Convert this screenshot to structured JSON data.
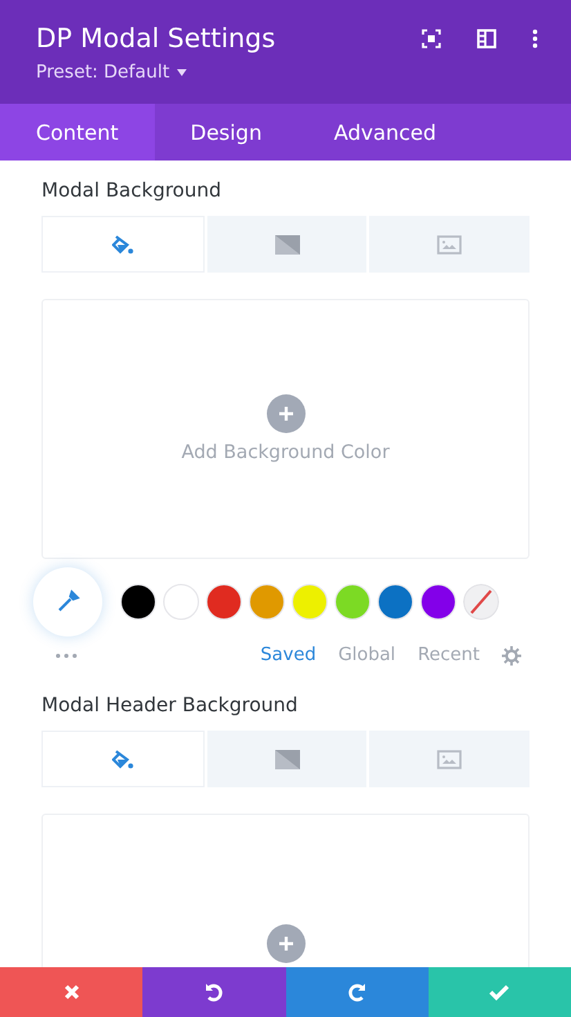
{
  "header": {
    "title": "DP Modal Settings",
    "preset": "Preset: Default"
  },
  "tabs": [
    {
      "label": "Content",
      "selected": true
    },
    {
      "label": "Design",
      "selected": false
    },
    {
      "label": "Advanced",
      "selected": false
    }
  ],
  "sections": [
    {
      "title": "Modal Background",
      "bg_types": [
        {
          "kind": "color",
          "selected": true
        },
        {
          "kind": "gradient",
          "selected": false
        },
        {
          "kind": "image",
          "selected": false
        }
      ],
      "add_label": "Add Background Color",
      "palette": {
        "swatches": [
          {
            "kind": "color",
            "color": "#000000"
          },
          {
            "kind": "color",
            "color": "#ffffff"
          },
          {
            "kind": "color",
            "color": "#e02b20"
          },
          {
            "kind": "color",
            "color": "#e09900"
          },
          {
            "kind": "color",
            "color": "#edf000"
          },
          {
            "kind": "color",
            "color": "#7cda24"
          },
          {
            "kind": "color",
            "color": "#0c71c3"
          },
          {
            "kind": "color",
            "color": "#8300e9"
          },
          {
            "kind": "none"
          }
        ],
        "sources": [
          {
            "label": "Saved",
            "selected": true
          },
          {
            "label": "Global",
            "selected": false
          },
          {
            "label": "Recent",
            "selected": false
          }
        ]
      }
    },
    {
      "title": "Modal Header Background",
      "bg_types": [
        {
          "kind": "color",
          "selected": true
        },
        {
          "kind": "gradient",
          "selected": false
        },
        {
          "kind": "image",
          "selected": false
        }
      ]
    }
  ],
  "footer": [
    {
      "kind": "discard"
    },
    {
      "kind": "undo"
    },
    {
      "kind": "redo"
    },
    {
      "kind": "save"
    }
  ]
}
